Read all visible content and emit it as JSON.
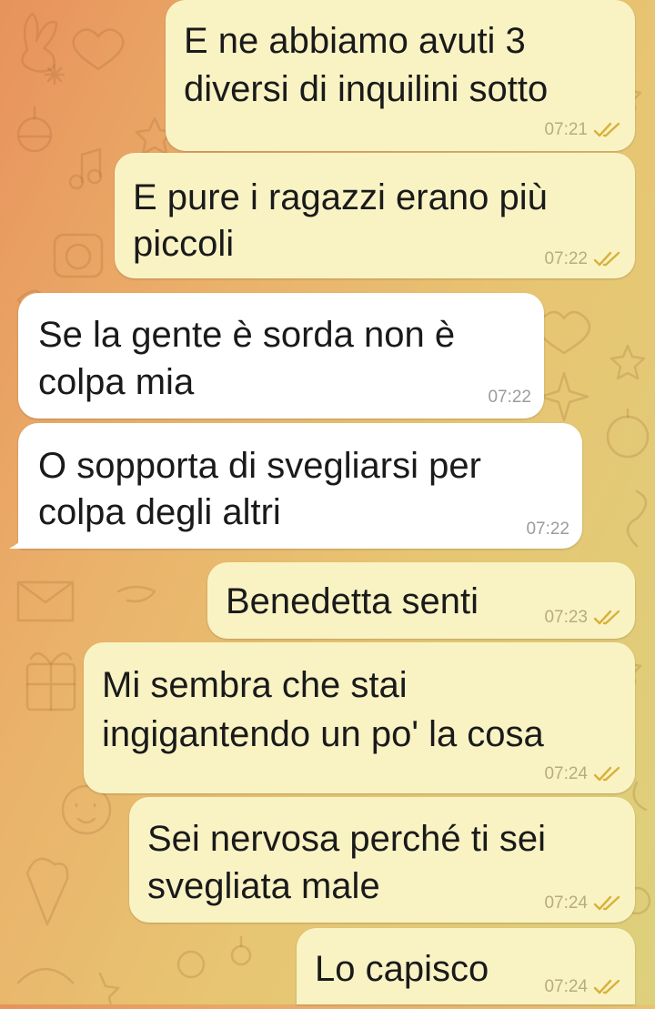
{
  "chat": {
    "messages": [
      {
        "direction": "out",
        "lines": [
          "E ne abbiamo avuti 3",
          "diversi di inquilini sotto"
        ],
        "time": "07:21",
        "read": true
      },
      {
        "direction": "out",
        "lines": [
          "E pure i ragazzi erano più",
          "piccoli"
        ],
        "time": "07:22",
        "read": true
      },
      {
        "direction": "in",
        "lines": [
          "Se la gente è sorda non è",
          "colpa mia"
        ],
        "time": "07:22",
        "read": false
      },
      {
        "direction": "in",
        "lines": [
          "O sopporta di svegliarsi per",
          "colpa degli altri"
        ],
        "time": "07:22",
        "read": false
      },
      {
        "direction": "out",
        "lines": [
          "Benedetta senti"
        ],
        "time": "07:23",
        "read": true
      },
      {
        "direction": "out",
        "lines": [
          "Mi sembra che stai",
          "ingigantendo un po' la cosa"
        ],
        "time": "07:24",
        "read": true
      },
      {
        "direction": "out",
        "lines": [
          "Sei nervosa perché ti sei",
          "svegliata male"
        ],
        "time": "07:24",
        "read": true
      },
      {
        "direction": "out",
        "lines": [
          "Lo capisco"
        ],
        "time": "07:24",
        "read": true
      }
    ]
  },
  "colors": {
    "outgoing_bubble": "#f9f3c4",
    "incoming_bubble": "#ffffff",
    "read_ticks": "#d9b13a"
  },
  "icons": {
    "read_receipt": "double-check-icon"
  }
}
